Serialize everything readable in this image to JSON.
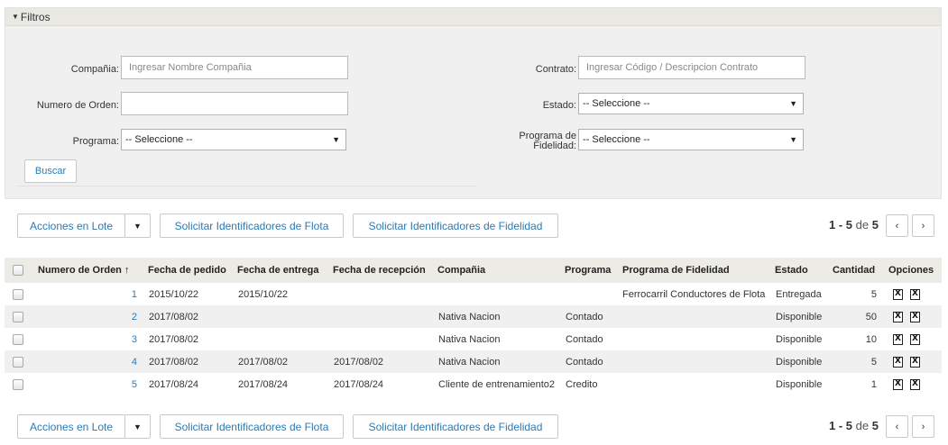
{
  "filters": {
    "title": "Filtros",
    "company_label": "Compañia:",
    "company_placeholder": "Ingresar Nombre Compañia",
    "contract_label": "Contrato:",
    "contract_placeholder": "Ingresar Código / Descripcion Contrato",
    "order_label": "Numero de Orden:",
    "order_value": "",
    "status_label": "Estado:",
    "status_value": "-- Seleccione --",
    "program_label": "Programa:",
    "program_value": "-- Seleccione --",
    "loyalty_label_1": "Programa de",
    "loyalty_label_2": "Fidelidad:",
    "loyalty_value": "-- Seleccione --",
    "search_button": "Buscar"
  },
  "toolbar": {
    "batch_actions": "Acciones en Lote",
    "caret": "▼",
    "fleet_ids": "Solicitar Identificadores de Flota",
    "loyalty_ids": "Solicitar Identificadores de Fidelidad"
  },
  "pager": {
    "range": "1 - 5",
    "of": "de",
    "total": "5",
    "prev": "‹",
    "next": "›"
  },
  "table": {
    "columns": {
      "order": "Numero de Orden",
      "sort": "↑",
      "order_date": "Fecha de pedido",
      "delivery_date": "Fecha de entrega",
      "reception_date": "Fecha de recepción",
      "company": "Compañia",
      "program": "Programa",
      "loyalty": "Programa de Fidelidad",
      "status": "Estado",
      "quantity": "Cantidad",
      "options": "Opciones"
    },
    "rows": [
      {
        "order": "1",
        "order_date": "2015/10/22",
        "delivery_date": "2015/10/22",
        "reception_date": "",
        "company": "",
        "program": "",
        "loyalty": "Ferrocarril Conductores de Flota",
        "status": "Entregada",
        "quantity": "5"
      },
      {
        "order": "2",
        "order_date": "2017/08/02",
        "delivery_date": "",
        "reception_date": "",
        "company": "Nativa Nacion",
        "program": "Contado",
        "loyalty": "",
        "status": "Disponible",
        "quantity": "50"
      },
      {
        "order": "3",
        "order_date": "2017/08/02",
        "delivery_date": "",
        "reception_date": "",
        "company": "Nativa Nacion",
        "program": "Contado",
        "loyalty": "",
        "status": "Disponible",
        "quantity": "10"
      },
      {
        "order": "4",
        "order_date": "2017/08/02",
        "delivery_date": "2017/08/02",
        "reception_date": "2017/08/02",
        "company": "Nativa Nacion",
        "program": "Contado",
        "loyalty": "",
        "status": "Disponible",
        "quantity": "5"
      },
      {
        "order": "5",
        "order_date": "2017/08/24",
        "delivery_date": "2017/08/24",
        "reception_date": "2017/08/24",
        "company": "Cliente de entrenamiento2",
        "program": "Credito",
        "loyalty": "",
        "status": "Disponible",
        "quantity": "1"
      }
    ],
    "option_icon": "X"
  },
  "colors": {
    "link": "#2a7ab3",
    "panel": "#f0f0f0",
    "header": "#ecebe6"
  },
  "icons": [
    "caret-down-icon",
    "excel-icon",
    "chevron-left-icon",
    "chevron-right-icon"
  ]
}
